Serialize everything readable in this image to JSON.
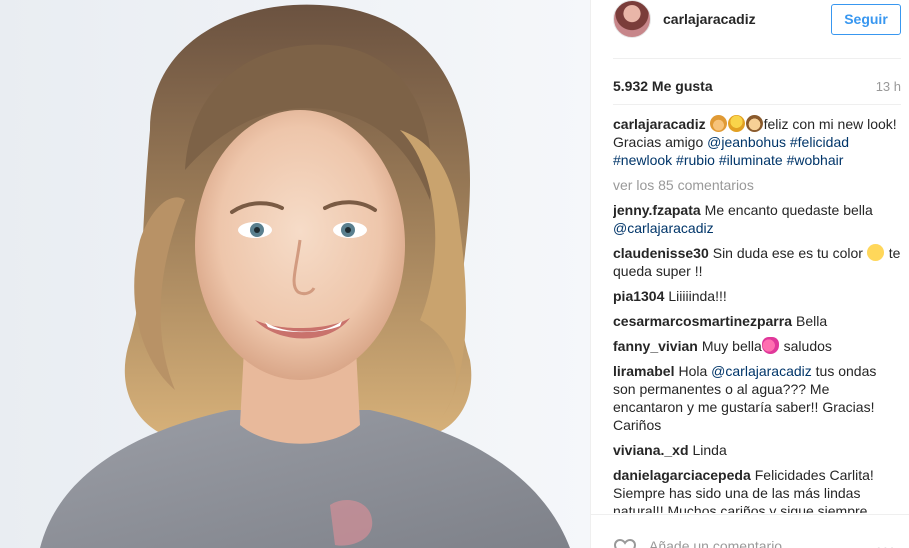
{
  "post": {
    "username": "carlajaracadiz",
    "follow_label": "Seguir",
    "likes": "5.932 Me gusta",
    "time": "13 h",
    "caption": {
      "username": "carlajaracadiz",
      "text_1": "feliz con mi new look! Gracias amigo ",
      "mention": "@jeanbohus",
      "tags": [
        "#felicidad",
        "#newlook",
        "#rubio",
        "#iluminate",
        "#wobhair"
      ]
    },
    "view_all": "ver los 85 comentarios",
    "comments": [
      {
        "user": "jenny.fzapata",
        "text": "Me encanto quedaste bella",
        "mention": "@carlajaracadiz",
        "text_after": ""
      },
      {
        "user": "claudenisse30",
        "text": "Sin duda ese es tu color",
        "after_emoji": "te queda super !!"
      },
      {
        "user": "pia1304",
        "text": "Liiiiinda!!!"
      },
      {
        "user": "cesarmarcosmartinezparra",
        "text": "Bella"
      },
      {
        "user": "fanny_vivian",
        "text": "Muy bella",
        "after_emoji": " saludos"
      },
      {
        "user": "liramabel",
        "text_before": "Hola ",
        "mention": "@carlajaracadiz",
        "text": " tus ondas son permanentes o al agua??? Me encantaron y me gustaría saber!! Gracias! Cariños"
      },
      {
        "user": "viviana._xd",
        "text": "Linda"
      },
      {
        "user": "danielagarciacepeda",
        "text": "Felicidades Carlita! Siempre has sido una de las más lindas natural!! Muchos cariños y sigue siempre"
      }
    ],
    "comment_placeholder": "Añade un comentario...",
    "more_label": "•••"
  },
  "icons": {
    "avatar": "profile-avatar",
    "heart": "heart-outline-icon",
    "more": "more-options-icon"
  }
}
